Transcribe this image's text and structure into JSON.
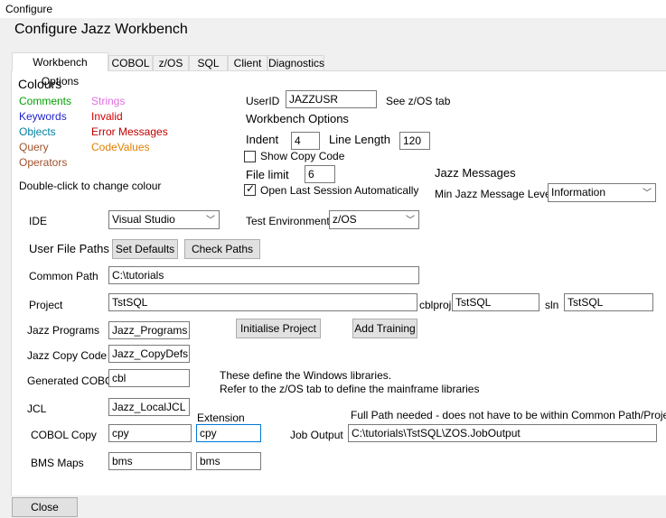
{
  "window": {
    "title": "Configure"
  },
  "heading": "Configure Jazz Workbench",
  "tabs": [
    {
      "label": "Workbench Options"
    },
    {
      "label": "COBOL"
    },
    {
      "label": "z/OS"
    },
    {
      "label": "SQL"
    },
    {
      "label": "Client"
    },
    {
      "label": "Diagnostics"
    }
  ],
  "colours": {
    "title": "Colours",
    "items": [
      {
        "label": "Comments",
        "color": "#00a000"
      },
      {
        "label": "Keywords",
        "color": "#1f1fd0"
      },
      {
        "label": "Objects",
        "color": "#0080a0"
      },
      {
        "label": "Query",
        "color": "#a0522d"
      },
      {
        "label": "Operators",
        "color": "#a0522d"
      },
      {
        "label": "Strings",
        "color": "#e070e0"
      },
      {
        "label": "Invalid",
        "color": "#d00000"
      },
      {
        "label": "Error Messages",
        "color": "#c00000"
      },
      {
        "label": "CodeValues",
        "color": "#e08000"
      }
    ],
    "hint": "Double-click to change colour"
  },
  "user": {
    "label": "UserID",
    "value": "JAZZUSR",
    "note": "See z/OS tab"
  },
  "workbench": {
    "title": "Workbench Options",
    "indent_label": "Indent",
    "indent_value": "4",
    "line_length_label": "Line Length",
    "line_length_value": "120",
    "show_copy_code": "Show Copy Code",
    "file_limit_label": "File limit",
    "file_limit_value": "6",
    "open_last_session": "Open Last Session Automatically"
  },
  "messages": {
    "title": "Jazz Messages",
    "min_level_label": "Min Jazz Message Level",
    "min_level_value": "Information"
  },
  "ide": {
    "label": "IDE",
    "value": "Visual Studio"
  },
  "test_env": {
    "label": "Test Environment",
    "value": "z/OS"
  },
  "paths": {
    "title": "User File Paths",
    "set_defaults": "Set Defaults",
    "check_paths": "Check Paths",
    "common_path_label": "Common Path",
    "common_path_value": "C:\\tutorials",
    "project_label": "Project",
    "project_value": "TstSQL",
    "cblproj_label": "cblproj",
    "cblproj_value": "TstSQL",
    "sln_label": "sln",
    "sln_value": "TstSQL",
    "jazz_programs_label": "Jazz Programs",
    "jazz_programs_value": "Jazz_Programs",
    "initialise_project": "Initialise Project",
    "add_training": "Add Training",
    "jazz_copy_label": "Jazz Copy Code",
    "jazz_copy_value": "Jazz_CopyDefs",
    "gen_cobol_label": "Generated COBOL",
    "gen_cobol_value": "cbl",
    "windows_note_1": "These define the Windows libraries.",
    "windows_note_2": "Refer to the z/OS tab to define the mainframe libraries",
    "jcl_label": "JCL",
    "jcl_value": "Jazz_LocalJCL",
    "extension_label": "Extension",
    "full_path_note": "Full Path needed - does not have to be within Common Path/Project",
    "cobol_copy_label": "COBOL Copy",
    "cobol_copy_value": "cpy",
    "cobol_copy_ext": "cpy",
    "job_output_label": "Job Output",
    "job_output_value": "C:\\tutorials\\TstSQL\\ZOS.JobOutput",
    "bms_label": "BMS Maps",
    "bms_value": "bms",
    "bms_ext": "bms"
  },
  "footer": {
    "close": "Close"
  }
}
